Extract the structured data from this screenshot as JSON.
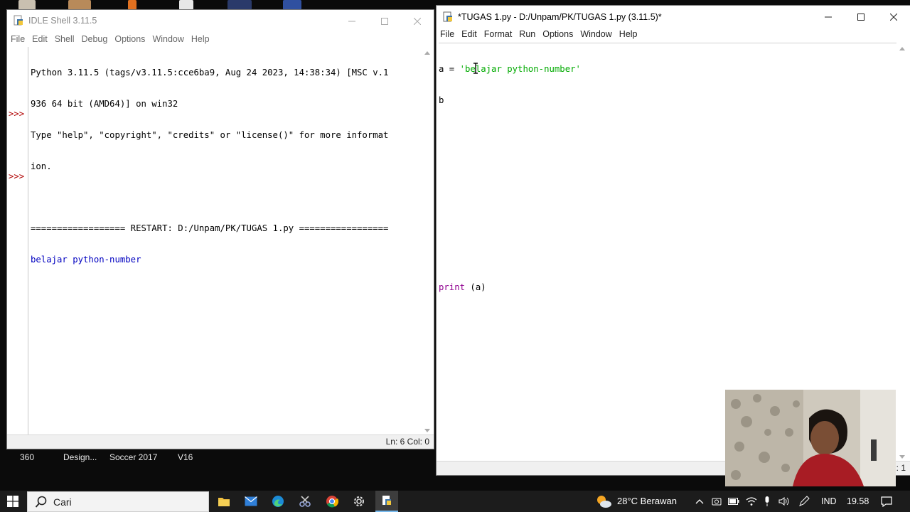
{
  "desktop": {
    "labels": [
      "360",
      "Design...",
      "Soccer 2017",
      "V16"
    ]
  },
  "shell": {
    "title": "IDLE Shell 3.11.5",
    "menu": [
      "File",
      "Edit",
      "Shell",
      "Debug",
      "Options",
      "Window",
      "Help"
    ],
    "lines": [
      "Python 3.11.5 (tags/v3.11.5:cce6ba9, Aug 24 2023, 14:38:34) [MSC v.1",
      "936 64 bit (AMD64)] on win32",
      "Type \"help\", \"copyright\", \"credits\" or \"license()\" for more informat",
      "ion.",
      "",
      "================== RESTART: D:/Unpam/PK/TUGAS 1.py =================",
      "belajar python-number"
    ],
    "prompt": ">>>",
    "status": "Ln: 6   Col: 0"
  },
  "editor": {
    "title": "*TUGAS 1.py - D:/Unpam/PK/TUGAS 1.py (3.11.5)*",
    "menu": [
      "File",
      "Edit",
      "Format",
      "Run",
      "Options",
      "Window",
      "Help"
    ],
    "code": {
      "line1_var": "a = ",
      "line1_str": "'belajar python-number'",
      "line2": "b",
      "print_kw": "print",
      "print_args": " (a)"
    },
    "status": "l: 1"
  },
  "taskbar": {
    "search_placeholder": "Cari",
    "weather": "28°C  Berawan",
    "language": "IND",
    "time": "19.58"
  },
  "colors": {
    "string": "#00aa00",
    "builtin": "#900090",
    "prompt": "#b00000",
    "shell_output": "#0000c0"
  }
}
